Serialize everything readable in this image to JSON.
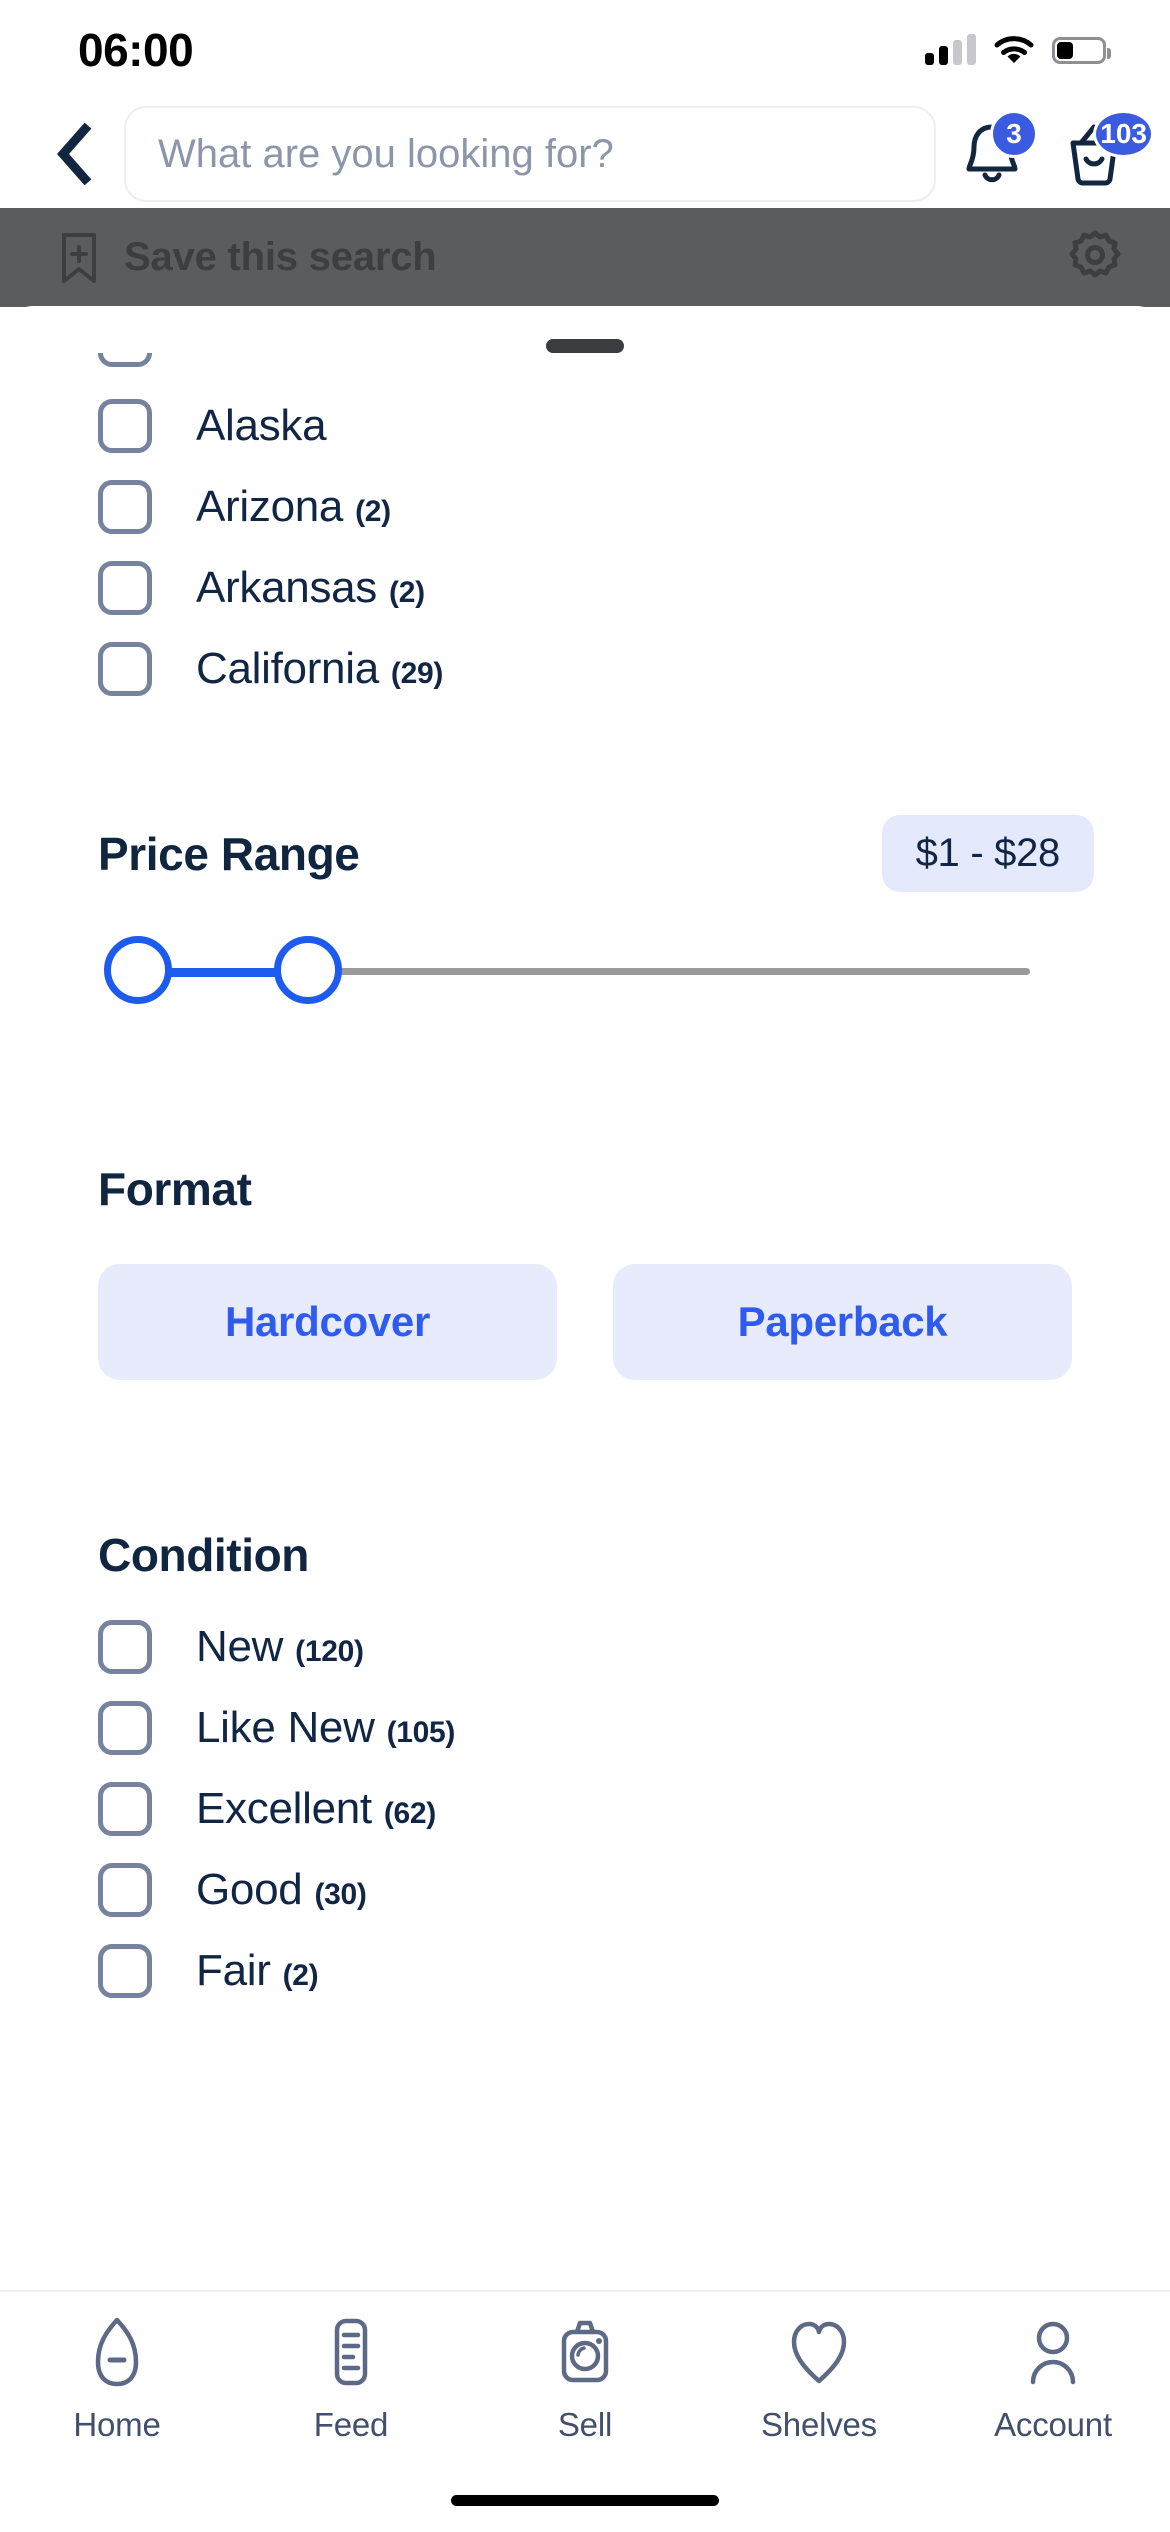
{
  "status_bar": {
    "time": "06:00",
    "signal_icon": "cellular-bars-icon",
    "wifi_icon": "wifi-icon",
    "battery_icon": "battery-icon",
    "battery_level_pct": 34
  },
  "header": {
    "back_icon": "chevron-left-icon",
    "search_placeholder": "What are you looking for?",
    "search_value": "",
    "notifications": {
      "icon": "bell-icon",
      "badge": "3"
    },
    "cart": {
      "icon": "basket-icon",
      "badge": "103"
    }
  },
  "save_bar": {
    "icon": "bookmark-plus-icon",
    "label": "Save this search",
    "settings_icon": "gear-icon",
    "background_color": "#5b5c60"
  },
  "sheet": {
    "grabber": "drag-handle",
    "states": {
      "items": [
        {
          "label": "Alaska",
          "count": "",
          "checked": false
        },
        {
          "label": "Arizona",
          "count": "(2)",
          "checked": false
        },
        {
          "label": "Arkansas",
          "count": "(2)",
          "checked": false
        },
        {
          "label": "California",
          "count": "(29)",
          "checked": false
        }
      ]
    },
    "price_range": {
      "title": "Price Range",
      "value_label": "$1 - $28",
      "min_value": 1,
      "max_value": 28,
      "accent_color": "#1d5bef"
    },
    "format": {
      "title": "Format",
      "options": [
        {
          "label": "Hardcover",
          "selected": false
        },
        {
          "label": "Paperback",
          "selected": false
        }
      ]
    },
    "condition": {
      "title": "Condition",
      "items": [
        {
          "label": "New",
          "count": "(120)",
          "checked": false
        },
        {
          "label": "Like New",
          "count": "(105)",
          "checked": false
        },
        {
          "label": "Excellent",
          "count": "(62)",
          "checked": false
        },
        {
          "label": "Good",
          "count": "(30)",
          "checked": false
        },
        {
          "label": "Fair",
          "count": "(2)",
          "checked": false
        }
      ]
    }
  },
  "tab_bar": {
    "tabs": [
      {
        "label": "Home",
        "icon": "home-icon"
      },
      {
        "label": "Feed",
        "icon": "feed-icon"
      },
      {
        "label": "Sell",
        "icon": "camera-icon"
      },
      {
        "label": "Shelves",
        "icon": "heart-icon"
      },
      {
        "label": "Account",
        "icon": "person-icon"
      }
    ]
  },
  "colors": {
    "accent_blue": "#2f5bf0",
    "chip_bg": "#e7ebfc",
    "text_navy": "#112545",
    "checkbox_border": "#76829e"
  }
}
